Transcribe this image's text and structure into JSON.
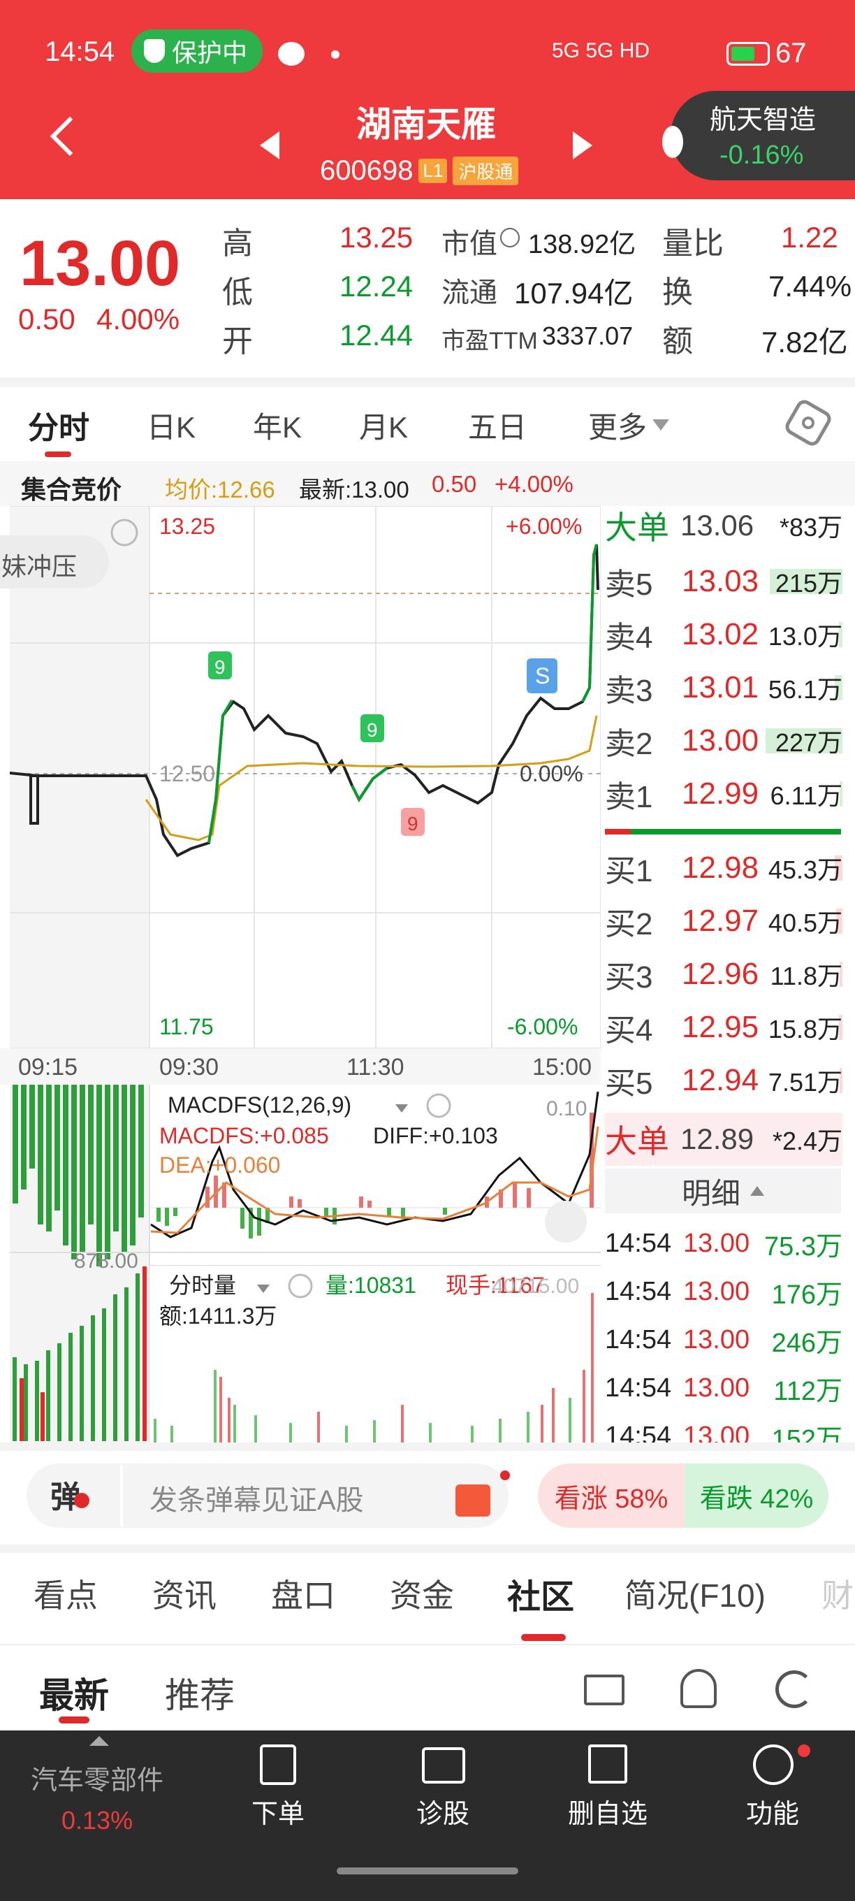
{
  "status": {
    "time": "14:54",
    "protect": "保护中",
    "signal": "5G 5G HD",
    "battery": "67"
  },
  "header": {
    "title": "湖南天雁",
    "code": "600698",
    "badge1": "L1",
    "badge2": "沪股通",
    "related_name": "航天智造",
    "related_change": "-0.16%"
  },
  "quote": {
    "price": "13.00",
    "change": "0.50",
    "pct": "4.00%",
    "high_l": "高",
    "high": "13.25",
    "low_l": "低",
    "low": "12.24",
    "open_l": "开",
    "open": "12.44",
    "mv_l": "市值",
    "mv": "138.92亿",
    "float_l": "流通",
    "float": "107.94亿",
    "pe_l": "市盈TTM",
    "pe": "3337.07",
    "vr_l": "量比",
    "vr": "1.22",
    "turn_l": "换",
    "turn": "7.44%",
    "amt_l": "额",
    "amt": "7.82亿"
  },
  "chart_tabs": [
    "分时",
    "日K",
    "年K",
    "月K",
    "五日",
    "更多"
  ],
  "info": {
    "auction": "集合竞价",
    "avg": "均价:12.66",
    "latest": "最新:13.00",
    "chg": "0.50",
    "pct": "+4.00%"
  },
  "chart": {
    "top_price": "13.25",
    "top_pct": "+6.00%",
    "mid_price": "12.50",
    "mid_pct": "0.00%",
    "bot_price": "11.75",
    "bot_pct": "-6.00%",
    "bubble": "妹冲压",
    "times": [
      "09:15",
      "09:30",
      "11:30",
      "15:00"
    ],
    "markers": [
      "9",
      "9",
      "9",
      "S"
    ]
  },
  "macd": {
    "title": "MACDFS(12,26,9)",
    "macd": "MACDFS:+0.085",
    "diff": "DIFF:+0.103",
    "dea": "DEA:+0.060",
    "right": "0.10",
    "left": "878.00"
  },
  "vol": {
    "title": "分时量",
    "qty": "量:10831",
    "now": "现手:1167",
    "amount": "额:1411.3万",
    "right": "40715.00"
  },
  "orderbook": {
    "big_top": {
      "label": "大单",
      "price": "13.06",
      "vol": "*83万"
    },
    "asks": [
      {
        "label": "卖5",
        "price": "13.03",
        "vol": "215万",
        "bar": 0.95
      },
      {
        "label": "卖4",
        "price": "13.02",
        "vol": "13.0万",
        "bar": 0.05
      },
      {
        "label": "卖3",
        "price": "13.01",
        "vol": "56.1万",
        "bar": 0.1
      },
      {
        "label": "卖2",
        "price": "13.00",
        "vol": "227万",
        "bar": 1.0
      },
      {
        "label": "卖1",
        "price": "12.99",
        "vol": "6.11万",
        "bar": 0.03
      }
    ],
    "bids": [
      {
        "label": "买1",
        "price": "12.98",
        "vol": "45.3万",
        "bar": 0.1
      },
      {
        "label": "买2",
        "price": "12.97",
        "vol": "40.5万",
        "bar": 0.08
      },
      {
        "label": "买3",
        "price": "12.96",
        "vol": "11.8万",
        "bar": 0.04
      },
      {
        "label": "买4",
        "price": "12.95",
        "vol": "15.8万",
        "bar": 0.05
      },
      {
        "label": "买5",
        "price": "12.94",
        "vol": "7.51万",
        "bar": 0.03
      }
    ],
    "big_bot": {
      "label": "大单",
      "price": "12.89",
      "vol": "*2.4万"
    },
    "detail_label": "明细",
    "ticks": [
      {
        "t": "14:54",
        "p": "13.00",
        "v": "75.3万"
      },
      {
        "t": "14:54",
        "p": "13.00",
        "v": "176万"
      },
      {
        "t": "14:54",
        "p": "13.00",
        "v": "246万"
      },
      {
        "t": "14:54",
        "p": "13.00",
        "v": "112万"
      },
      {
        "t": "14:54",
        "p": "13.00",
        "v": "152万"
      }
    ]
  },
  "danmu": {
    "icon": "弹",
    "placeholder": "发条弹幕见证A股",
    "up": "看涨 58%",
    "down": "看跌 42%"
  },
  "sections": [
    "看点",
    "资讯",
    "盘口",
    "资金",
    "社区",
    "简况(F10)",
    "财"
  ],
  "subtabs": [
    "最新",
    "推荐"
  ],
  "nav": {
    "sector": "汽车零部件",
    "sector_pct": "0.13%",
    "items": [
      "下单",
      "诊股",
      "删自选",
      "功能"
    ]
  },
  "colors": {
    "red": "#ee3a3c",
    "green": "#0a9a2e",
    "up": "#e02a2a"
  }
}
